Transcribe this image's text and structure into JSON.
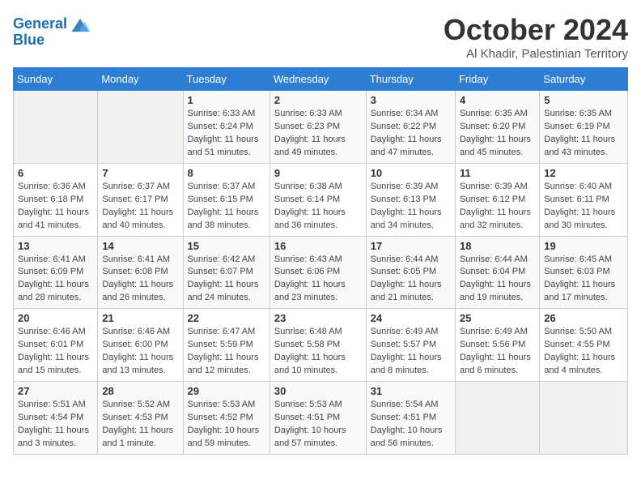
{
  "header": {
    "logo_line1": "General",
    "logo_line2": "Blue",
    "title": "October 2024",
    "subtitle": "Al Khadir, Palestinian Territory"
  },
  "days_of_week": [
    "Sunday",
    "Monday",
    "Tuesday",
    "Wednesday",
    "Thursday",
    "Friday",
    "Saturday"
  ],
  "weeks": [
    [
      {
        "day": "",
        "info": ""
      },
      {
        "day": "",
        "info": ""
      },
      {
        "day": "1",
        "info": "Sunrise: 6:33 AM\nSunset: 6:24 PM\nDaylight: 11 hours and 51 minutes."
      },
      {
        "day": "2",
        "info": "Sunrise: 6:33 AM\nSunset: 6:23 PM\nDaylight: 11 hours and 49 minutes."
      },
      {
        "day": "3",
        "info": "Sunrise: 6:34 AM\nSunset: 6:22 PM\nDaylight: 11 hours and 47 minutes."
      },
      {
        "day": "4",
        "info": "Sunrise: 6:35 AM\nSunset: 6:20 PM\nDaylight: 11 hours and 45 minutes."
      },
      {
        "day": "5",
        "info": "Sunrise: 6:35 AM\nSunset: 6:19 PM\nDaylight: 11 hours and 43 minutes."
      }
    ],
    [
      {
        "day": "6",
        "info": "Sunrise: 6:36 AM\nSunset: 6:18 PM\nDaylight: 11 hours and 41 minutes."
      },
      {
        "day": "7",
        "info": "Sunrise: 6:37 AM\nSunset: 6:17 PM\nDaylight: 11 hours and 40 minutes."
      },
      {
        "day": "8",
        "info": "Sunrise: 6:37 AM\nSunset: 6:15 PM\nDaylight: 11 hours and 38 minutes."
      },
      {
        "day": "9",
        "info": "Sunrise: 6:38 AM\nSunset: 6:14 PM\nDaylight: 11 hours and 36 minutes."
      },
      {
        "day": "10",
        "info": "Sunrise: 6:39 AM\nSunset: 6:13 PM\nDaylight: 11 hours and 34 minutes."
      },
      {
        "day": "11",
        "info": "Sunrise: 6:39 AM\nSunset: 6:12 PM\nDaylight: 11 hours and 32 minutes."
      },
      {
        "day": "12",
        "info": "Sunrise: 6:40 AM\nSunset: 6:11 PM\nDaylight: 11 hours and 30 minutes."
      }
    ],
    [
      {
        "day": "13",
        "info": "Sunrise: 6:41 AM\nSunset: 6:09 PM\nDaylight: 11 hours and 28 minutes."
      },
      {
        "day": "14",
        "info": "Sunrise: 6:41 AM\nSunset: 6:08 PM\nDaylight: 11 hours and 26 minutes."
      },
      {
        "day": "15",
        "info": "Sunrise: 6:42 AM\nSunset: 6:07 PM\nDaylight: 11 hours and 24 minutes."
      },
      {
        "day": "16",
        "info": "Sunrise: 6:43 AM\nSunset: 6:06 PM\nDaylight: 11 hours and 23 minutes."
      },
      {
        "day": "17",
        "info": "Sunrise: 6:44 AM\nSunset: 6:05 PM\nDaylight: 11 hours and 21 minutes."
      },
      {
        "day": "18",
        "info": "Sunrise: 6:44 AM\nSunset: 6:04 PM\nDaylight: 11 hours and 19 minutes."
      },
      {
        "day": "19",
        "info": "Sunrise: 6:45 AM\nSunset: 6:03 PM\nDaylight: 11 hours and 17 minutes."
      }
    ],
    [
      {
        "day": "20",
        "info": "Sunrise: 6:46 AM\nSunset: 6:01 PM\nDaylight: 11 hours and 15 minutes."
      },
      {
        "day": "21",
        "info": "Sunrise: 6:46 AM\nSunset: 6:00 PM\nDaylight: 11 hours and 13 minutes."
      },
      {
        "day": "22",
        "info": "Sunrise: 6:47 AM\nSunset: 5:59 PM\nDaylight: 11 hours and 12 minutes."
      },
      {
        "day": "23",
        "info": "Sunrise: 6:48 AM\nSunset: 5:58 PM\nDaylight: 11 hours and 10 minutes."
      },
      {
        "day": "24",
        "info": "Sunrise: 6:49 AM\nSunset: 5:57 PM\nDaylight: 11 hours and 8 minutes."
      },
      {
        "day": "25",
        "info": "Sunrise: 6:49 AM\nSunset: 5:56 PM\nDaylight: 11 hours and 6 minutes."
      },
      {
        "day": "26",
        "info": "Sunrise: 5:50 AM\nSunset: 4:55 PM\nDaylight: 11 hours and 4 minutes."
      }
    ],
    [
      {
        "day": "27",
        "info": "Sunrise: 5:51 AM\nSunset: 4:54 PM\nDaylight: 11 hours and 3 minutes."
      },
      {
        "day": "28",
        "info": "Sunrise: 5:52 AM\nSunset: 4:53 PM\nDaylight: 11 hours and 1 minute."
      },
      {
        "day": "29",
        "info": "Sunrise: 5:53 AM\nSunset: 4:52 PM\nDaylight: 10 hours and 59 minutes."
      },
      {
        "day": "30",
        "info": "Sunrise: 5:53 AM\nSunset: 4:51 PM\nDaylight: 10 hours and 57 minutes."
      },
      {
        "day": "31",
        "info": "Sunrise: 5:54 AM\nSunset: 4:51 PM\nDaylight: 10 hours and 56 minutes."
      },
      {
        "day": "",
        "info": ""
      },
      {
        "day": "",
        "info": ""
      }
    ]
  ]
}
